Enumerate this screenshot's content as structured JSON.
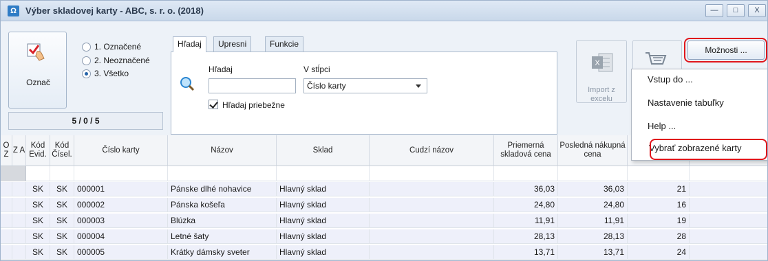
{
  "window": {
    "title": "Výber skladovej karty - ABC, s. r. o. (2018)",
    "controls": {
      "minimize": "—",
      "maximize": "□",
      "close": "X"
    }
  },
  "toolbar": {
    "oznac_label": "Označ",
    "filter_options": [
      {
        "label": "1. Označené",
        "selected": false
      },
      {
        "label": "2. Neoznačené",
        "selected": false
      },
      {
        "label": "3. Všetko",
        "selected": true
      }
    ],
    "counter": "5 / 0 / 5",
    "tabs": [
      "Hľadaj",
      "Upresni",
      "Funkcie"
    ],
    "active_tab": "Hľadaj",
    "search": {
      "label": "Hľadaj",
      "value": "",
      "column_label": "V stĺpci",
      "column_value": "Číslo karty",
      "incremental_label": "Hľadaj priebežne",
      "incremental_checked": true
    },
    "import_label": "Import z excelu",
    "moznosti_label": "Možnosti ..."
  },
  "menu": {
    "items": [
      "Vstup do ...",
      "Nastavenie tabuľky",
      "Help ...",
      "Vybrať zobrazené karty"
    ]
  },
  "grid": {
    "columns": [
      "O Z",
      "Z A",
      "Kód Evid.",
      "Kód Čísel.",
      "Číslo karty",
      "Názov",
      "Sklad",
      "Cudzí názov",
      "Priemerná skladová cena",
      "Posledná nákupná cena",
      ""
    ],
    "rows": [
      {
        "kod_evid": "SK",
        "kod_cisel": "SK",
        "cislo": "000001",
        "nazov": "Pánske dlhé nohavice",
        "sklad": "Hlavný sklad",
        "cudzi": "",
        "priemerna": "36,03",
        "posledna": "36,03",
        "extra": "21"
      },
      {
        "kod_evid": "SK",
        "kod_cisel": "SK",
        "cislo": "000002",
        "nazov": "Pánska košeľa",
        "sklad": "Hlavný sklad",
        "cudzi": "",
        "priemerna": "24,80",
        "posledna": "24,80",
        "extra": "16"
      },
      {
        "kod_evid": "SK",
        "kod_cisel": "SK",
        "cislo": "000003",
        "nazov": "Blúzka",
        "sklad": "Hlavný sklad",
        "cudzi": "",
        "priemerna": "11,91",
        "posledna": "11,91",
        "extra": "19"
      },
      {
        "kod_evid": "SK",
        "kod_cisel": "SK",
        "cislo": "000004",
        "nazov": "Letné šaty",
        "sklad": "Hlavný sklad",
        "cudzi": "",
        "priemerna": "28,13",
        "posledna": "28,13",
        "extra": "28"
      },
      {
        "kod_evid": "SK",
        "kod_cisel": "SK",
        "cislo": "000005",
        "nazov": "Krátky dámsky sveter",
        "sklad": "Hlavný sklad",
        "cudzi": "",
        "priemerna": "13,71",
        "posledna": "13,71",
        "extra": "24"
      }
    ]
  },
  "colors": {
    "highlight": "#e0151b",
    "accent": "#2f7cc5"
  }
}
